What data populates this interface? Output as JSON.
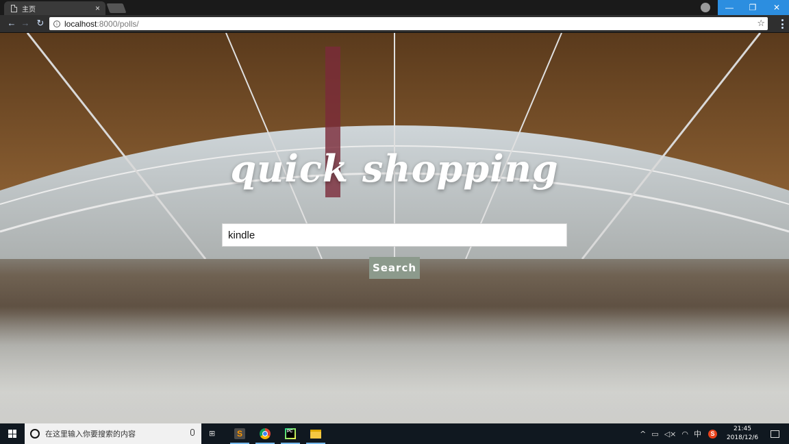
{
  "browser": {
    "tab_title": "主页",
    "tab_close": "×",
    "url_host": "localhost",
    "url_rest": ":8000/polls/"
  },
  "window_controls": {
    "minimize": "—",
    "maximize": "❐",
    "close": "✕"
  },
  "page": {
    "title": "quick shopping",
    "search_value": "kindle",
    "search_button": "Search"
  },
  "taskbar": {
    "search_placeholder": "在这里输入你要搜索的内容",
    "tray_chevron": "^",
    "tray_ime": "中",
    "tray_sogou": "S",
    "time": "21:45",
    "date": "2018/12/6"
  },
  "colors": {
    "search_button_bg": "#8c9a8c",
    "title_text": "#ffffff",
    "taskbar_bg": "#101820",
    "window_button_bg": "#2c8ee0"
  },
  "icons": [
    "doc-icon",
    "close-icon",
    "back-icon",
    "forward-icon",
    "reload-icon",
    "info-icon",
    "star-icon",
    "menu-icon",
    "windows-icon",
    "cortana-icon",
    "mic-icon",
    "taskview-icon",
    "sublime-icon",
    "chrome-icon",
    "pycharm-icon",
    "explorer-icon",
    "battery-icon",
    "volume-muted-icon",
    "wifi-icon",
    "sogou-icon",
    "notification-icon"
  ]
}
